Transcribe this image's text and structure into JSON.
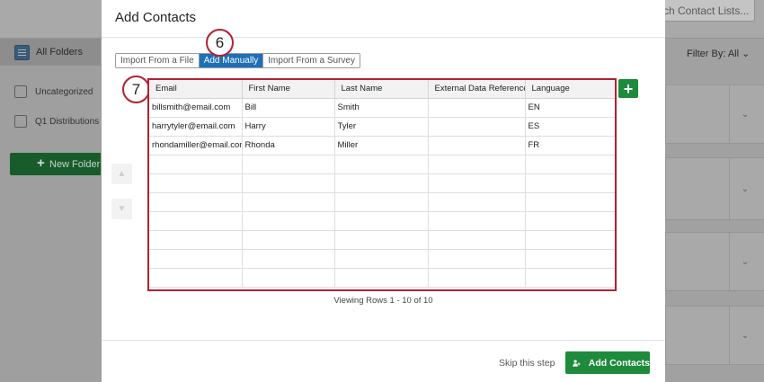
{
  "background": {
    "search_placeholder": "ch Contact Lists...",
    "folders": {
      "all": "All Folders",
      "uncategorized": "Uncategorized",
      "q1": "Q1 Distributions"
    },
    "new_folder_label": "New Folder",
    "filter_label": "Filter By: All"
  },
  "modal": {
    "title": "Add Contacts",
    "tabs": [
      "Import From a File",
      "Add Manually",
      "Import From a Survey"
    ],
    "active_tab": "Add Manually",
    "steps": {
      "tabs_step": "6",
      "table_step": "7"
    },
    "table": {
      "columns": [
        "Email",
        "First Name",
        "Last Name",
        "External Data Reference",
        "Language"
      ],
      "rows": [
        [
          "billsmith@email.com",
          "Bill",
          "Smith",
          "",
          "EN"
        ],
        [
          "harrytyler@email.com",
          "Harry",
          "Tyler",
          "",
          "ES"
        ],
        [
          "rhondamiller@email.com",
          "Rhonda",
          "Miller",
          "",
          "FR"
        ],
        [
          "",
          "",
          "",
          "",
          ""
        ],
        [
          "",
          "",
          "",
          "",
          ""
        ],
        [
          "",
          "",
          "",
          "",
          ""
        ],
        [
          "",
          "",
          "",
          "",
          ""
        ],
        [
          "",
          "",
          "",
          "",
          ""
        ],
        [
          "",
          "",
          "",
          "",
          ""
        ],
        [
          "",
          "",
          "",
          "",
          ""
        ]
      ]
    },
    "row_info": "Viewing Rows 1 - 10 of 10",
    "footer": {
      "skip_label": "Skip this step",
      "add_label": "Add Contacts"
    }
  },
  "colors": {
    "accent_blue": "#1d6fb8",
    "primary_green": "#1e8a3c",
    "highlight_red": "#b32033"
  }
}
